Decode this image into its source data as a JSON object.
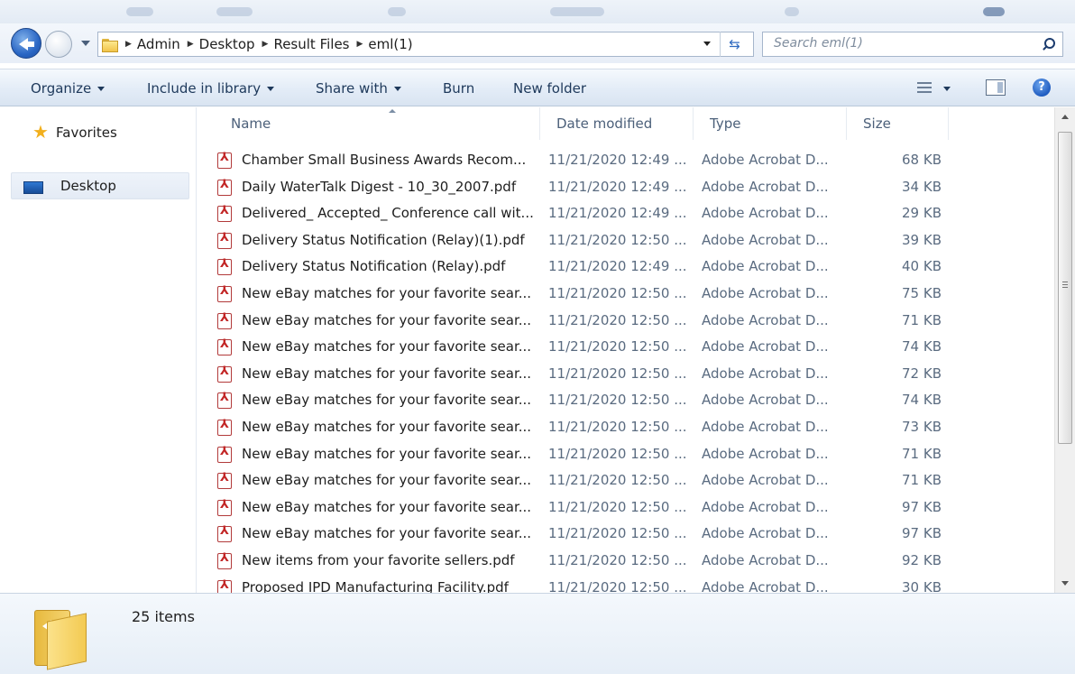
{
  "window": {
    "breadcrumb": [
      "Admin",
      "Desktop",
      "Result Files",
      "eml(1)"
    ],
    "search_placeholder": "Search eml(1)"
  },
  "toolbar": {
    "organize": "Organize",
    "include_in_library": "Include in library",
    "share_with": "Share with",
    "burn": "Burn",
    "new_folder": "New folder"
  },
  "nav": {
    "favorites": "Favorites",
    "desktop": "Desktop"
  },
  "columns": {
    "name": "Name",
    "date": "Date modified",
    "type": "Type",
    "size": "Size"
  },
  "files": [
    {
      "name": "Chamber Small Business Awards Recom...",
      "date": "11/21/2020 12:49 ...",
      "type": "Adobe Acrobat D...",
      "size": "68 KB"
    },
    {
      "name": "Daily WaterTalk Digest - 10_30_2007.pdf",
      "date": "11/21/2020 12:49 ...",
      "type": "Adobe Acrobat D...",
      "size": "34 KB"
    },
    {
      "name": "Delivered_ Accepted_ Conference call wit...",
      "date": "11/21/2020 12:49 ...",
      "type": "Adobe Acrobat D...",
      "size": "29 KB"
    },
    {
      "name": "Delivery Status Notification (Relay)(1).pdf",
      "date": "11/21/2020 12:50 ...",
      "type": "Adobe Acrobat D...",
      "size": "39 KB"
    },
    {
      "name": "Delivery Status Notification (Relay).pdf",
      "date": "11/21/2020 12:49 ...",
      "type": "Adobe Acrobat D...",
      "size": "40 KB"
    },
    {
      "name": "New eBay matches for your favorite sear...",
      "date": "11/21/2020 12:50 ...",
      "type": "Adobe Acrobat D...",
      "size": "75 KB"
    },
    {
      "name": "New eBay matches for your favorite sear...",
      "date": "11/21/2020 12:50 ...",
      "type": "Adobe Acrobat D...",
      "size": "71 KB"
    },
    {
      "name": "New eBay matches for your favorite sear...",
      "date": "11/21/2020 12:50 ...",
      "type": "Adobe Acrobat D...",
      "size": "74 KB"
    },
    {
      "name": "New eBay matches for your favorite sear...",
      "date": "11/21/2020 12:50 ...",
      "type": "Adobe Acrobat D...",
      "size": "72 KB"
    },
    {
      "name": "New eBay matches for your favorite sear...",
      "date": "11/21/2020 12:50 ...",
      "type": "Adobe Acrobat D...",
      "size": "74 KB"
    },
    {
      "name": "New eBay matches for your favorite sear...",
      "date": "11/21/2020 12:50 ...",
      "type": "Adobe Acrobat D...",
      "size": "73 KB"
    },
    {
      "name": "New eBay matches for your favorite sear...",
      "date": "11/21/2020 12:50 ...",
      "type": "Adobe Acrobat D...",
      "size": "71 KB"
    },
    {
      "name": "New eBay matches for your favorite sear...",
      "date": "11/21/2020 12:50 ...",
      "type": "Adobe Acrobat D...",
      "size": "71 KB"
    },
    {
      "name": "New eBay matches for your favorite sear...",
      "date": "11/21/2020 12:50 ...",
      "type": "Adobe Acrobat D...",
      "size": "97 KB"
    },
    {
      "name": "New eBay matches for your favorite sear...",
      "date": "11/21/2020 12:50 ...",
      "type": "Adobe Acrobat D...",
      "size": "97 KB"
    },
    {
      "name": "New items from your favorite sellers.pdf",
      "date": "11/21/2020 12:50 ...",
      "type": "Adobe Acrobat D...",
      "size": "92 KB"
    },
    {
      "name": "Proposed IPD Manufacturing Facility.pdf",
      "date": "11/21/2020 12:50 ...",
      "type": "Adobe Acrobat D...",
      "size": "30 KB"
    }
  ],
  "details": {
    "item_count": "25 items"
  },
  "icons": {
    "file": "pdf-icon",
    "favorites": "star-icon",
    "desktop": "desktop-icon",
    "folder": "folder-icon"
  }
}
